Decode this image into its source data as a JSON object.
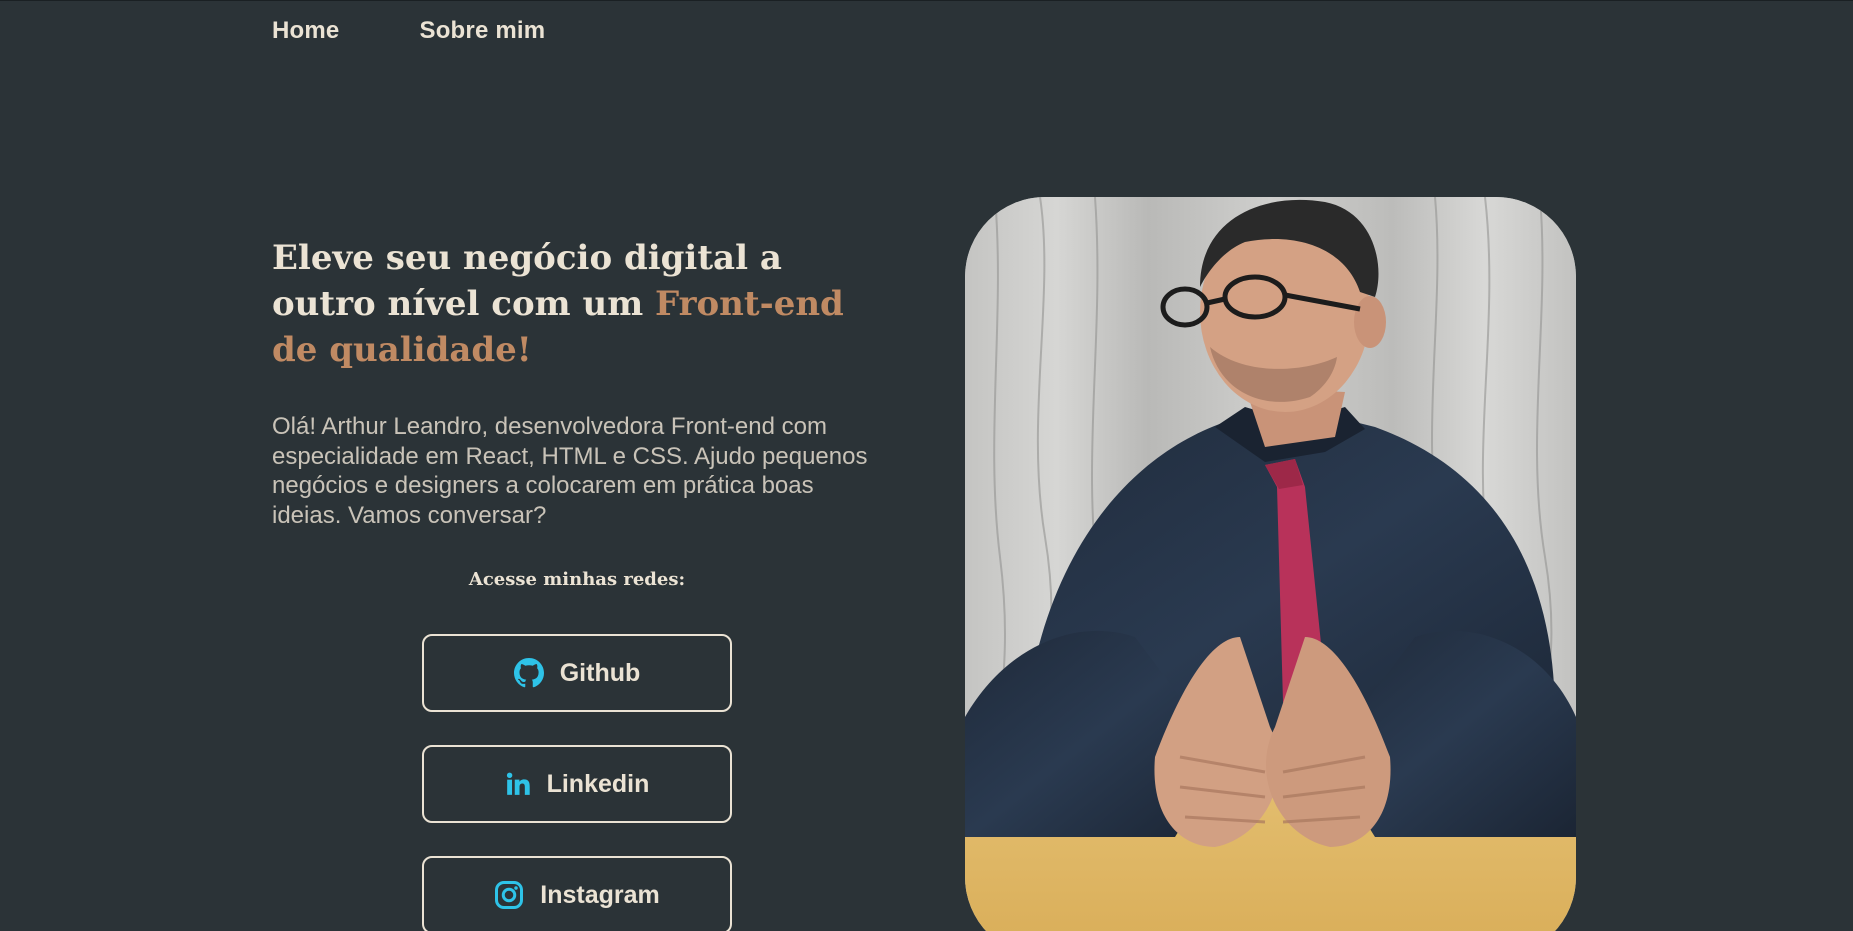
{
  "nav": {
    "items": [
      {
        "label": "Home"
      },
      {
        "label": "Sobre mim"
      }
    ]
  },
  "hero": {
    "title_part1": "Eleve seu negócio digital a outro nível com um ",
    "title_accent": "Front-end de qualidade!",
    "intro": "Olá! Arthur Leandro, desenvolvedora Front-end com especialidade em React, HTML e CSS. Ajudo pequenos negócios e designers a colocarem em prática boas ideias. Vamos conversar?"
  },
  "social": {
    "heading": "Acesse minhas redes:",
    "buttons": [
      {
        "label": "Github",
        "icon": "github-icon"
      },
      {
        "label": "Linkedin",
        "icon": "linkedin-icon"
      },
      {
        "label": "Instagram",
        "icon": "instagram-icon"
      }
    ]
  },
  "photo": {
    "alt": "Arthur Leandro"
  },
  "colors": {
    "background": "#2b3337",
    "text": "#ebe3d4",
    "accent": "#c08a63",
    "icon": "#2ec3e8"
  }
}
